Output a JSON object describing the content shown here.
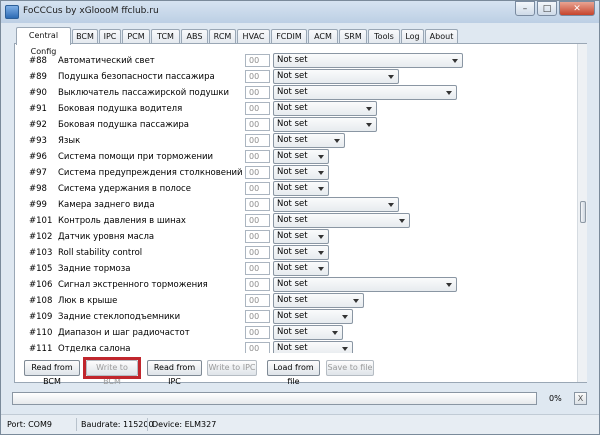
{
  "window": {
    "title": "FoCCCus by xGloooM ffclub.ru"
  },
  "tabs": [
    "Central Config",
    "BCM",
    "IPC",
    "PCM",
    "TCM",
    "ABS",
    "RCM",
    "HVAC",
    "FCDIM",
    "ACM",
    "SRM",
    "Tools",
    "Log",
    "About"
  ],
  "active_tab": "Central Config",
  "rows": [
    {
      "num": "#88",
      "label": "Автоматический свет",
      "code": "00",
      "value": "Not set"
    },
    {
      "num": "#89",
      "label": "Подушка безопасности пассажира",
      "code": "00",
      "value": "Not set"
    },
    {
      "num": "#90",
      "label": "Выключатель пассажирской подушки",
      "code": "00",
      "value": "Not set"
    },
    {
      "num": "#91",
      "label": "Боковая подушка водителя",
      "code": "00",
      "value": "Not set"
    },
    {
      "num": "#92",
      "label": "Боковая подушка пассажира",
      "code": "00",
      "value": "Not set"
    },
    {
      "num": "#93",
      "label": "Язык",
      "code": "00",
      "value": "Not set"
    },
    {
      "num": "#96",
      "label": "Система помощи при торможении",
      "code": "00",
      "value": "Not set"
    },
    {
      "num": "#97",
      "label": "Система предупреждения столкновений",
      "code": "00",
      "value": "Not set"
    },
    {
      "num": "#98",
      "label": "Система удержания в полосе",
      "code": "00",
      "value": "Not set"
    },
    {
      "num": "#99",
      "label": "Камера заднего вида",
      "code": "00",
      "value": "Not set"
    },
    {
      "num": "#101",
      "label": "Контроль давления в шинах",
      "code": "00",
      "value": "Not set"
    },
    {
      "num": "#102",
      "label": "Датчик уровня масла",
      "code": "00",
      "value": "Not set"
    },
    {
      "num": "#103",
      "label": "Roll stability control",
      "code": "00",
      "value": "Not set"
    },
    {
      "num": "#105",
      "label": "Задние тормоза",
      "code": "00",
      "value": "Not set"
    },
    {
      "num": "#106",
      "label": "Сигнал экстренного торможения",
      "code": "00",
      "value": "Not set"
    },
    {
      "num": "#108",
      "label": "Люк в крыше",
      "code": "00",
      "value": "Not set"
    },
    {
      "num": "#109",
      "label": "Задние стеклоподъемники",
      "code": "00",
      "value": "Not set"
    },
    {
      "num": "#110",
      "label": "Диапазон и шаг радиочастот",
      "code": "00",
      "value": "Not set"
    },
    {
      "num": "#111",
      "label": "Отделка салона",
      "code": "00",
      "value": "Not set"
    }
  ],
  "buttons": {
    "read_bcm": "Read from BCM",
    "write_bcm": "Write to BCM",
    "read_ipc": "Read from IPC",
    "write_ipc": "Write to IPC",
    "load_file": "Load from file",
    "save_file": "Save to file"
  },
  "progress": {
    "value": 0,
    "label": "0%"
  },
  "cancel_label": "X",
  "status": {
    "port": "Port: COM9",
    "baudrate": "Baudrate: 115200",
    "device": "Device: ELM327"
  },
  "colors": {
    "highlight": "#c0262d",
    "progress_fill": "#59b64a"
  }
}
